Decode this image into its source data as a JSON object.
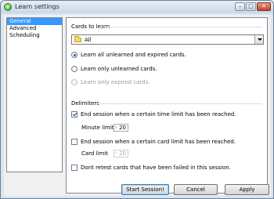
{
  "window": {
    "title": "Learn settings",
    "controls": {
      "minimize": "–",
      "maximize": "□",
      "close": "✕"
    }
  },
  "nav": {
    "items": [
      {
        "label": "General",
        "selected": true
      },
      {
        "label": "Advanced",
        "selected": false
      },
      {
        "label": "Scheduling",
        "selected": false
      }
    ]
  },
  "cards_to_learn": {
    "heading": "Cards to learn",
    "folder": {
      "value": "All",
      "icon": "folder-icon"
    },
    "options": [
      {
        "label": "Learn all unlearned and expired cards.",
        "checked": true,
        "enabled": true
      },
      {
        "label": "Learn only unlearned cards.",
        "checked": false,
        "enabled": true
      },
      {
        "label": "Learn only expired cards.",
        "checked": false,
        "enabled": false
      }
    ]
  },
  "delimiters": {
    "heading": "Delimiters",
    "time_limit": {
      "label": "End session when a certain time limit has been reached.",
      "checked": true
    },
    "minute_limit": {
      "label": "Minute limit",
      "value": "20",
      "enabled": true
    },
    "card_limit_toggle": {
      "label": "End session when a certain card limit has been reached.",
      "checked": false
    },
    "card_limit": {
      "label": "Card limit",
      "value": "20",
      "enabled": false
    },
    "no_retest": {
      "label": "Dont retest cards that have been failed in this session.",
      "checked": false
    }
  },
  "footer": {
    "start_label": "Start Session!",
    "cancel_label": "Cancel",
    "apply_label": "Apply"
  },
  "colors": {
    "selection": "#3399ff",
    "window_frame": "#dbe5ef",
    "default_button_border": "#3c7fb1"
  }
}
